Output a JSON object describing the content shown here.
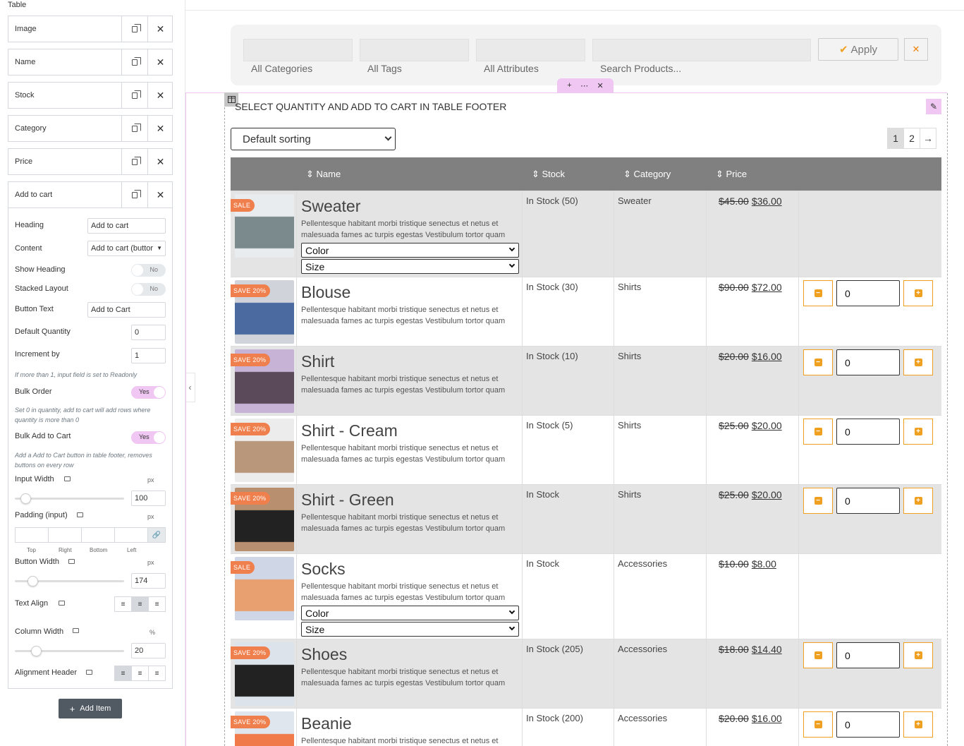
{
  "sidebar": {
    "section_title": "Table",
    "items": [
      {
        "label": "Image"
      },
      {
        "label": "Name"
      },
      {
        "label": "Stock"
      },
      {
        "label": "Category"
      },
      {
        "label": "Price"
      },
      {
        "label": "Add to cart"
      }
    ],
    "controls": {
      "heading_label": "Heading",
      "heading_value": "Add to cart",
      "content_label": "Content",
      "content_value": "Add to cart (buttor",
      "show_heading_label": "Show Heading",
      "show_heading_value": "No",
      "stacked_layout_label": "Stacked Layout",
      "stacked_layout_value": "No",
      "button_text_label": "Button Text",
      "button_text_value": "Add to Cart",
      "default_qty_label": "Default Quantity",
      "default_qty_value": "0",
      "increment_label": "Increment by",
      "increment_value": "1",
      "increment_help": "If more than 1, input field is set to Readonly",
      "bulk_order_label": "Bulk Order",
      "bulk_order_value": "Yes",
      "bulk_order_help": "Set 0 in quantity, add to cart will add rows where quantity is more than 0",
      "bulk_add_label": "Bulk Add to Cart",
      "bulk_add_value": "Yes",
      "bulk_add_help": "Add a Add to Cart button in table footer, removes buttons on every row",
      "input_width_label": "Input Width",
      "input_width_unit": "px",
      "input_width_value": "100",
      "padding_label": "Padding (input)",
      "padding_unit": "px",
      "padding_top": "Top",
      "padding_right": "Right",
      "padding_bottom": "Bottom",
      "padding_left": "Left",
      "button_width_label": "Button Width",
      "button_width_unit": "px",
      "button_width_value": "174",
      "text_align_label": "Text Align",
      "column_width_label": "Column Width",
      "column_width_unit": "%",
      "column_width_value": "20",
      "alignment_header_label": "Alignment Header"
    },
    "add_item_label": "Add Item"
  },
  "filters": {
    "categories": "All Categories",
    "tags": "All Tags",
    "attributes": "All Attributes",
    "search": "Search Products...",
    "apply": "Apply"
  },
  "widget": {
    "footer_note": "SELECT QUANTITY AND ADD TO CART IN TABLE FOOTER",
    "sorting": "Default sorting",
    "pages": [
      "1",
      "2"
    ]
  },
  "table": {
    "headers": {
      "name": "Name",
      "stock": "Stock",
      "category": "Category",
      "price": "Price"
    },
    "description": "Pellentesque habitant morbi tristique senectus et netus et malesuada fames ac turpis egestas Vestibulum tortor quam",
    "variation_labels": {
      "color": "Color",
      "size": "Size"
    },
    "rows": [
      {
        "badge": "SALE",
        "name": "Sweater",
        "stock": "In Stock (50)",
        "category": "Sweater",
        "old_price": "$45.00",
        "new_price": "$36.00",
        "variations": true,
        "qty": null
      },
      {
        "badge": "SAVE 20%",
        "name": "Blouse",
        "stock": "In Stock (30)",
        "category": "Shirts",
        "old_price": "$90.00",
        "new_price": "$72.00",
        "variations": false,
        "qty": "0"
      },
      {
        "badge": "SAVE 20%",
        "name": "Shirt",
        "stock": "In Stock (10)",
        "category": "Shirts",
        "old_price": "$20.00",
        "new_price": "$16.00",
        "variations": false,
        "qty": "0"
      },
      {
        "badge": "SAVE 20%",
        "name": "Shirt - Cream",
        "stock": "In Stock (5)",
        "category": "Shirts",
        "old_price": "$25.00",
        "new_price": "$20.00",
        "variations": false,
        "qty": "0"
      },
      {
        "badge": "SAVE 20%",
        "name": "Shirt - Green",
        "stock": "In Stock",
        "category": "Shirts",
        "old_price": "$25.00",
        "new_price": "$20.00",
        "variations": false,
        "qty": "0"
      },
      {
        "badge": "SALE",
        "name": "Socks",
        "stock": "In Stock",
        "category": "Accessories",
        "old_price": "$10.00",
        "new_price": "$8.00",
        "variations": true,
        "qty": null
      },
      {
        "badge": "SAVE 20%",
        "name": "Shoes",
        "stock": "In Stock (205)",
        "category": "Accessories",
        "old_price": "$18.00",
        "new_price": "$14.40",
        "variations": false,
        "qty": "0"
      },
      {
        "badge": "SAVE 20%",
        "name": "Beanie",
        "stock": "In Stock (200)",
        "category": "Accessories",
        "old_price": "$20.00",
        "new_price": "$16.00",
        "variations": false,
        "qty": "0"
      }
    ]
  },
  "colors": {
    "accent": "#f0a020",
    "badge": "#ef7f4c",
    "header": "#808080",
    "editor_pink": "#f0c6f3"
  }
}
